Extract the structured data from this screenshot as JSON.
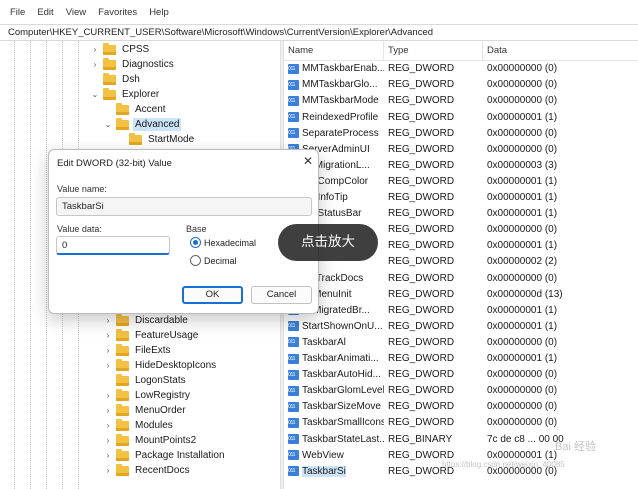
{
  "menubar": [
    "File",
    "Edit",
    "View",
    "Favorites",
    "Help"
  ],
  "address": "Computer\\HKEY_CURRENT_USER\\Software\\Microsoft\\Windows\\CurrentVersion\\Explorer\\Advanced",
  "tree": [
    {
      "label": "CPSS",
      "expander": "›"
    },
    {
      "label": "Diagnostics",
      "expander": "›"
    },
    {
      "label": "Dsh",
      "expander": ""
    },
    {
      "label": "Explorer",
      "expander": "⌄"
    },
    {
      "label": "Accent",
      "expander": ""
    },
    {
      "label": "Advanced",
      "expander": "⌄"
    },
    {
      "label": "StartMode",
      "expander": ""
    },
    {
      "label": "Discardable",
      "expander": "›"
    },
    {
      "label": "FeatureUsage",
      "expander": "›"
    },
    {
      "label": "FileExts",
      "expander": "›"
    },
    {
      "label": "HideDesktopIcons",
      "expander": "›"
    },
    {
      "label": "LogonStats",
      "expander": ""
    },
    {
      "label": "LowRegistry",
      "expander": "›"
    },
    {
      "label": "MenuOrder",
      "expander": "›"
    },
    {
      "label": "Modules",
      "expander": "›"
    },
    {
      "label": "MountPoints2",
      "expander": "›"
    },
    {
      "label": "Package Installation",
      "expander": "›"
    },
    {
      "label": "RecentDocs",
      "expander": "›"
    }
  ],
  "list": {
    "headers": [
      "Name",
      "Type",
      "Data"
    ],
    "rows": [
      {
        "name": "MMTaskbarEnab...",
        "type": "REG_DWORD",
        "data": "0x00000000 (0)"
      },
      {
        "name": "MMTaskbarGlo...",
        "type": "REG_DWORD",
        "data": "0x00000000 (0)"
      },
      {
        "name": "MMTaskbarMode",
        "type": "REG_DWORD",
        "data": "0x00000000 (0)"
      },
      {
        "name": "ReindexedProfile",
        "type": "REG_DWORD",
        "data": "0x00000001 (1)"
      },
      {
        "name": "SeparateProcess",
        "type": "REG_DWORD",
        "data": "0x00000000 (0)"
      },
      {
        "name": "ServerAdminUI",
        "type": "REG_DWORD",
        "data": "0x00000000 (0)"
      },
      {
        "name": "...llMigrationL...",
        "type": "REG_DWORD",
        "data": "0x00000003 (3)"
      },
      {
        "name": "...wCompColor",
        "type": "REG_DWORD",
        "data": "0x00000001 (1)"
      },
      {
        "name": "...wInfoTip",
        "type": "REG_DWORD",
        "data": "0x00000001 (1)"
      },
      {
        "name": "...wStatusBar",
        "type": "REG_DWORD",
        "data": "0x00000001 (1)"
      },
      {
        "name": "...",
        "type": "REG_DWORD",
        "data": "0x00000000 (0)"
      },
      {
        "name": "...",
        "type": "REG_DWORD",
        "data": "0x00000001 (1)"
      },
      {
        "name": "...",
        "type": "REG_DWORD",
        "data": "0x00000002 (2)"
      },
      {
        "name": "..._TrackDocs",
        "type": "REG_DWORD",
        "data": "0x00000000 (0)"
      },
      {
        "name": "...tMenuInit",
        "type": "REG_DWORD",
        "data": "0x0000000d (13)"
      },
      {
        "name": "...tMigratedBr...",
        "type": "REG_DWORD",
        "data": "0x00000001 (1)"
      },
      {
        "name": "StartShownOnU...",
        "type": "REG_DWORD",
        "data": "0x00000001 (1)"
      },
      {
        "name": "TaskbarAl",
        "type": "REG_DWORD",
        "data": "0x00000000 (0)"
      },
      {
        "name": "TaskbarAnimati...",
        "type": "REG_DWORD",
        "data": "0x00000001 (1)"
      },
      {
        "name": "TaskbarAutoHid...",
        "type": "REG_DWORD",
        "data": "0x00000000 (0)"
      },
      {
        "name": "TaskbarGlomLevel",
        "type": "REG_DWORD",
        "data": "0x00000000 (0)"
      },
      {
        "name": "TaskbarSizeMove",
        "type": "REG_DWORD",
        "data": "0x00000000 (0)"
      },
      {
        "name": "TaskbarSmallIcons",
        "type": "REG_DWORD",
        "data": "0x00000000 (0)"
      },
      {
        "name": "TaskbarStateLast...",
        "type": "REG_BINARY",
        "data": "7c de c8 ... 00 00"
      },
      {
        "name": "WebView",
        "type": "REG_DWORD",
        "data": "0x00000001 (1)"
      },
      {
        "name": "TaskbarSi",
        "type": "REG_DWORD",
        "data": "0x00000000 (0)"
      }
    ]
  },
  "dialog": {
    "title": "Edit DWORD (32-bit) Value",
    "close": "✕",
    "value_name_label": "Value name:",
    "value_name": "TaskbarSi",
    "value_data_label": "Value data:",
    "value_data": "0",
    "base_label": "Base",
    "base_hex": "Hexadecimal",
    "base_dec": "Decimal",
    "ok": "OK",
    "cancel": "Cancel"
  },
  "overlay": {
    "zoom_label": "点击放大"
  },
  "watermark": {
    "logo": "Bai 经验",
    "url": "https://blog.csdn.net/weixin_40085"
  }
}
